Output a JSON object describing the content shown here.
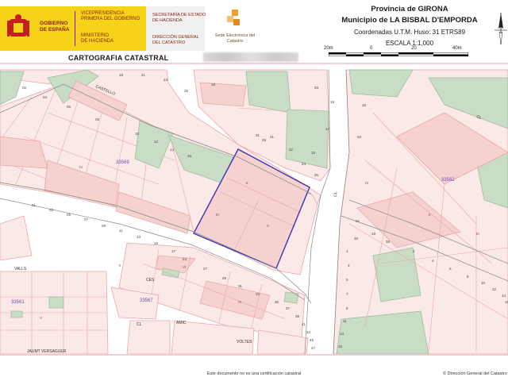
{
  "header": {
    "gov_name": [
      "GOBIERNO",
      "DE ESPAÑA"
    ],
    "vice_text": [
      "VICEPRESIDENCIA",
      "PRIMERA DEL GOBIERNO"
    ],
    "min_text": [
      "MINISTERIO",
      "DE HACIENDA"
    ],
    "sec_text": [
      "SECRETARÍA DE ESTADO",
      "DE HACIENDA"
    ],
    "dir_text": [
      "DIRECCIÓN GENERAL",
      "DEL CATASTRO"
    ],
    "sede_text": "Sede Electrónica del Catastro",
    "provincia": "Provincia de GIRONA",
    "municipio": "Municipio de LA BISBAL D'EMPORDA",
    "coordenadas": "Coordenadas U.T.M. Huso: 31 ETRS89",
    "escala": "ESCALA 1:1,000",
    "scale_ticks": [
      "20m",
      "0",
      "20",
      "40m"
    ],
    "title": "CARTOGRAFIA CATASTRAL"
  },
  "map": {
    "colors": {
      "parcel_fill": "#fbe9e8",
      "parcel_line": "#e9a6a8",
      "build_fill": "#f5d2cf",
      "green": "#c9dcc6",
      "green_dark": "#b7cfb4",
      "street": "#ffffff",
      "selection": "#3a33b5",
      "street_text": "#333333",
      "polygon_text": "#6a4ab5",
      "number_text": "#444444"
    },
    "polygon_labels": [
      "33569",
      "33562",
      "33567",
      "33561",
      "33562",
      "33567"
    ],
    "street_labels": [
      "CASTELLO",
      "CL",
      "CES",
      "VALLS",
      "JAUMT VERSAGUER",
      "AMIC",
      "VOLTES",
      "CL",
      "CL"
    ],
    "numbers": [
      "18",
      "21",
      "23",
      "25",
      "19",
      "03",
      "15",
      "17",
      "19",
      "21",
      "22",
      "24",
      "26",
      "28",
      "31",
      "16",
      "14",
      "12",
      "10",
      "08",
      "06",
      "04",
      "02",
      "01",
      "03",
      "05",
      "07",
      "09",
      "11",
      "13",
      "15",
      "17",
      "23",
      "27",
      "29",
      "31",
      "33",
      "35",
      "37",
      "39",
      "41",
      "43",
      "45",
      "47",
      "16",
      "04",
      "01",
      "19",
      "1",
      "3",
      "5",
      "7",
      "9",
      "11",
      "13",
      "15",
      "30",
      "38",
      "2",
      "4",
      "6",
      "8",
      "10",
      "12",
      "14",
      "16"
    ],
    "lot_codes": [
      "IV",
      "II",
      "III",
      "V",
      "II",
      "VI",
      "IV",
      "II",
      "III",
      "IV",
      "V"
    ]
  },
  "footer": {
    "notice": "Este documento no es una certificación catastral",
    "copyright": "© Dirección General del Catastro"
  }
}
